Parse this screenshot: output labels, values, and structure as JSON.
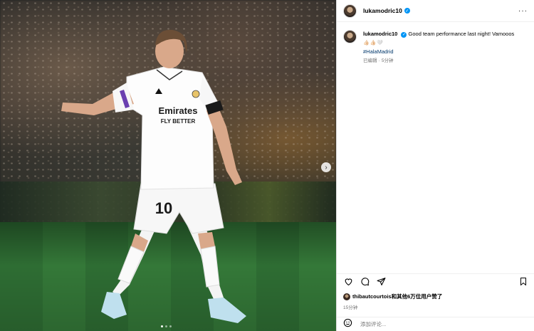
{
  "post": {
    "author": "lukamodric10",
    "caption_user": "lukamodric10",
    "caption_text": "Good team performance last night! Vamooos",
    "caption_emoji": "👍🏻👍🏻🤍",
    "hashtag": "#HalaMadrid",
    "edited_label": "已编辑",
    "age": "5分钟",
    "meta_separator": "·"
  },
  "photo": {
    "jersey_sponsor_line1": "Emirates",
    "jersey_sponsor_line2": "FLY BETTER",
    "shorts_number": "10",
    "carousel": {
      "count": 3,
      "active": 1
    }
  },
  "likes": {
    "text": "thibautcourtois和其他6万位用户赞了"
  },
  "time_ago": "15分钟",
  "comment_placeholder": "添加评论...",
  "icons": {
    "more": "more-icon",
    "heart": "heart-icon",
    "comment": "comment-icon",
    "share": "share-icon",
    "save": "bookmark-icon",
    "emoji": "emoji-icon",
    "next": "chevron-right-icon",
    "verified": "verified-badge-icon"
  },
  "colors": {
    "verified": "#0095f6",
    "hashtag": "#00376b",
    "meta": "#737373"
  }
}
